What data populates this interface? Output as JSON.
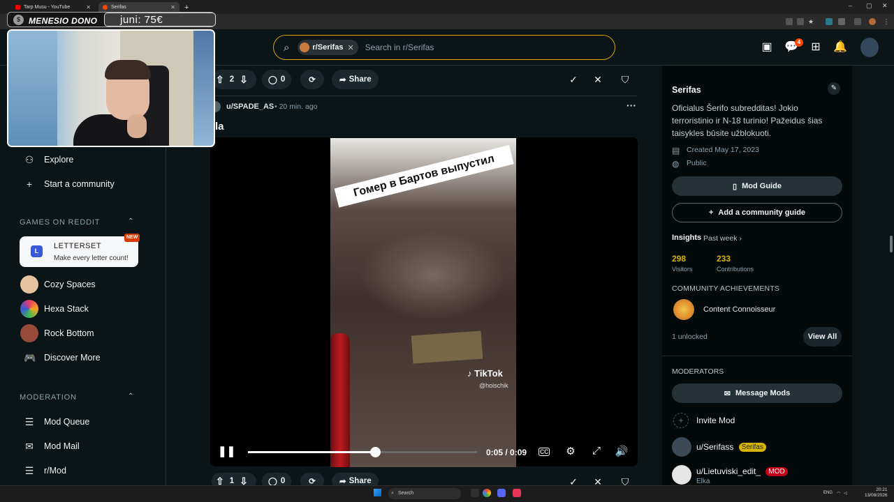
{
  "browser": {
    "tabs": [
      {
        "title": "Tarp Musu - YouTube",
        "favicon_color": "#ff0000"
      },
      {
        "title": "Serifas",
        "favicon_color": "#ff4500"
      }
    ]
  },
  "overlay": {
    "donation_label": "MENESIO DONO",
    "donation_value": "juni: 75€",
    "coin_icon": "$"
  },
  "header": {
    "search_chip": "r/Serifas",
    "search_placeholder": "Search in r/Serifas",
    "notification_count": "4"
  },
  "sidebar": {
    "items_top": [
      {
        "label": "Explore",
        "icon": "explore-icon"
      },
      {
        "label": "Start a community",
        "icon": "plus-icon"
      }
    ],
    "games_heading": "GAMES ON REDDIT",
    "featured_game": {
      "badge": "L",
      "title": "LETTERSET",
      "subtitle": "Make every letter count!",
      "new_label": "NEW"
    },
    "games": [
      {
        "label": "Cozy Spaces",
        "color": "#e7c3a0"
      },
      {
        "label": "Hexa Stack",
        "color": "#e63b6a"
      },
      {
        "label": "Rock Bottom",
        "color": "#9a4a3a"
      },
      {
        "label": "Discover More",
        "color": ""
      }
    ],
    "moderation_heading": "MODERATION",
    "moderation": [
      {
        "label": "Mod Queue"
      },
      {
        "label": "Mod Mail"
      },
      {
        "label": "r/Mod"
      }
    ]
  },
  "post_top": {
    "votes": "2",
    "comments": "0",
    "share_label": "Share"
  },
  "post": {
    "author": "u/SPADE_AS",
    "time": "• 20 min. ago",
    "title_fragment": "la",
    "more": "···",
    "video": {
      "caption": "Гомер в Бартов выпустил",
      "watermark": "TikTok",
      "watermark_handle": "@hoischik",
      "time": "0:05 / 0:09",
      "progress": 0.556
    }
  },
  "post_bottom": {
    "votes": "1",
    "comments": "0",
    "share_label": "Share"
  },
  "community": {
    "name": "Serifas",
    "description": "Oficialus Šerifo subredditas! Jokio terroristinio ir N-18 turinio! Pažeidus šias taisykles būsite užblokuoti.",
    "created": "Created May 17, 2023",
    "visibility": "Public",
    "mod_guide": "Mod Guide",
    "add_guide": "Add a community guide",
    "insights_label": "Insights",
    "insights_period": "Past week",
    "visitors": "298",
    "visitors_label": "Visitors",
    "contributions": "233",
    "contributions_label": "Contributions",
    "achievements_heading": "COMMUNITY ACHIEVEMENTS",
    "achievement": "Content Connoisseur",
    "unlocked": "1 unlocked",
    "view_all": "View All",
    "moderators_heading": "MODERATORS",
    "message_mods": "Message Mods",
    "invite_mod": "Invite Mod",
    "mods": [
      {
        "name": "u/Serifass",
        "flair": "Serifas",
        "flair_color": "#d7b400",
        "sub": ""
      },
      {
        "name": "u/Lietuviski_edit_",
        "flair": "MOD",
        "flair_color": "#c2001a",
        "sub": "Elka"
      }
    ]
  },
  "taskbar": {
    "search": "Search",
    "lang": "ENG",
    "time": "20:21",
    "date": "13/08/2026"
  },
  "colors": {
    "accent": "#d7a700",
    "reddit_orange": "#ff4500",
    "bg": "#0b1416"
  }
}
